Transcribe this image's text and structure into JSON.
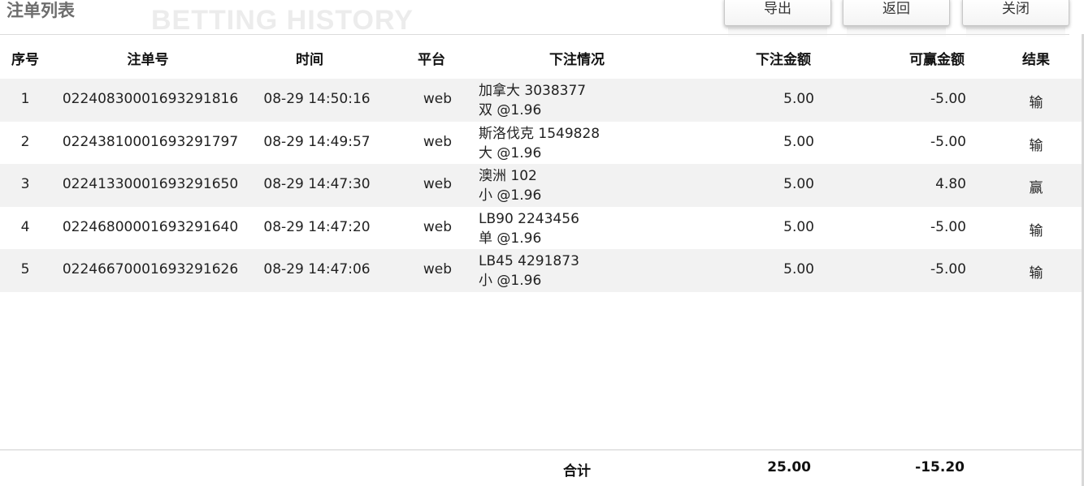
{
  "page": {
    "title": "注单列表",
    "watermark": "BETTING HISTORY"
  },
  "toolbar": {
    "export_label": "导出",
    "back_label": "返回",
    "close_label": "关闭"
  },
  "table": {
    "columns": [
      "序号",
      "注单号",
      "时间",
      "平台",
      "下注情况",
      "下注金额",
      "可赢金额",
      "结果"
    ],
    "rows": [
      {
        "index": "1",
        "order_no": "02240830001693291816",
        "time": "08-29 14:50:16",
        "platform": "web",
        "detail_line1": "加拿大 3038377",
        "detail_line2": "双 @1.96",
        "amount": "5.00",
        "win": "-5.00",
        "result": "输"
      },
      {
        "index": "2",
        "order_no": "02243810001693291797",
        "time": "08-29 14:49:57",
        "platform": "web",
        "detail_line1": "斯洛伐克 1549828",
        "detail_line2": "大 @1.96",
        "amount": "5.00",
        "win": "-5.00",
        "result": "输"
      },
      {
        "index": "3",
        "order_no": "02241330001693291650",
        "time": "08-29 14:47:30",
        "platform": "web",
        "detail_line1": "澳洲 102",
        "detail_line2": "小 @1.96",
        "amount": "5.00",
        "win": "4.80",
        "result": "赢"
      },
      {
        "index": "4",
        "order_no": "02246800001693291640",
        "time": "08-29 14:47:20",
        "platform": "web",
        "detail_line1": "LB90 2243456",
        "detail_line2": "单 @1.96",
        "amount": "5.00",
        "win": "-5.00",
        "result": "输"
      },
      {
        "index": "5",
        "order_no": "02246670001693291626",
        "time": "08-29 14:47:06",
        "platform": "web",
        "detail_line1": "LB45 4291873",
        "detail_line2": "小 @1.96",
        "amount": "5.00",
        "win": "-5.00",
        "result": "输"
      }
    ]
  },
  "totals": {
    "label": "合计",
    "amount": "25.00",
    "win": "-15.20"
  }
}
